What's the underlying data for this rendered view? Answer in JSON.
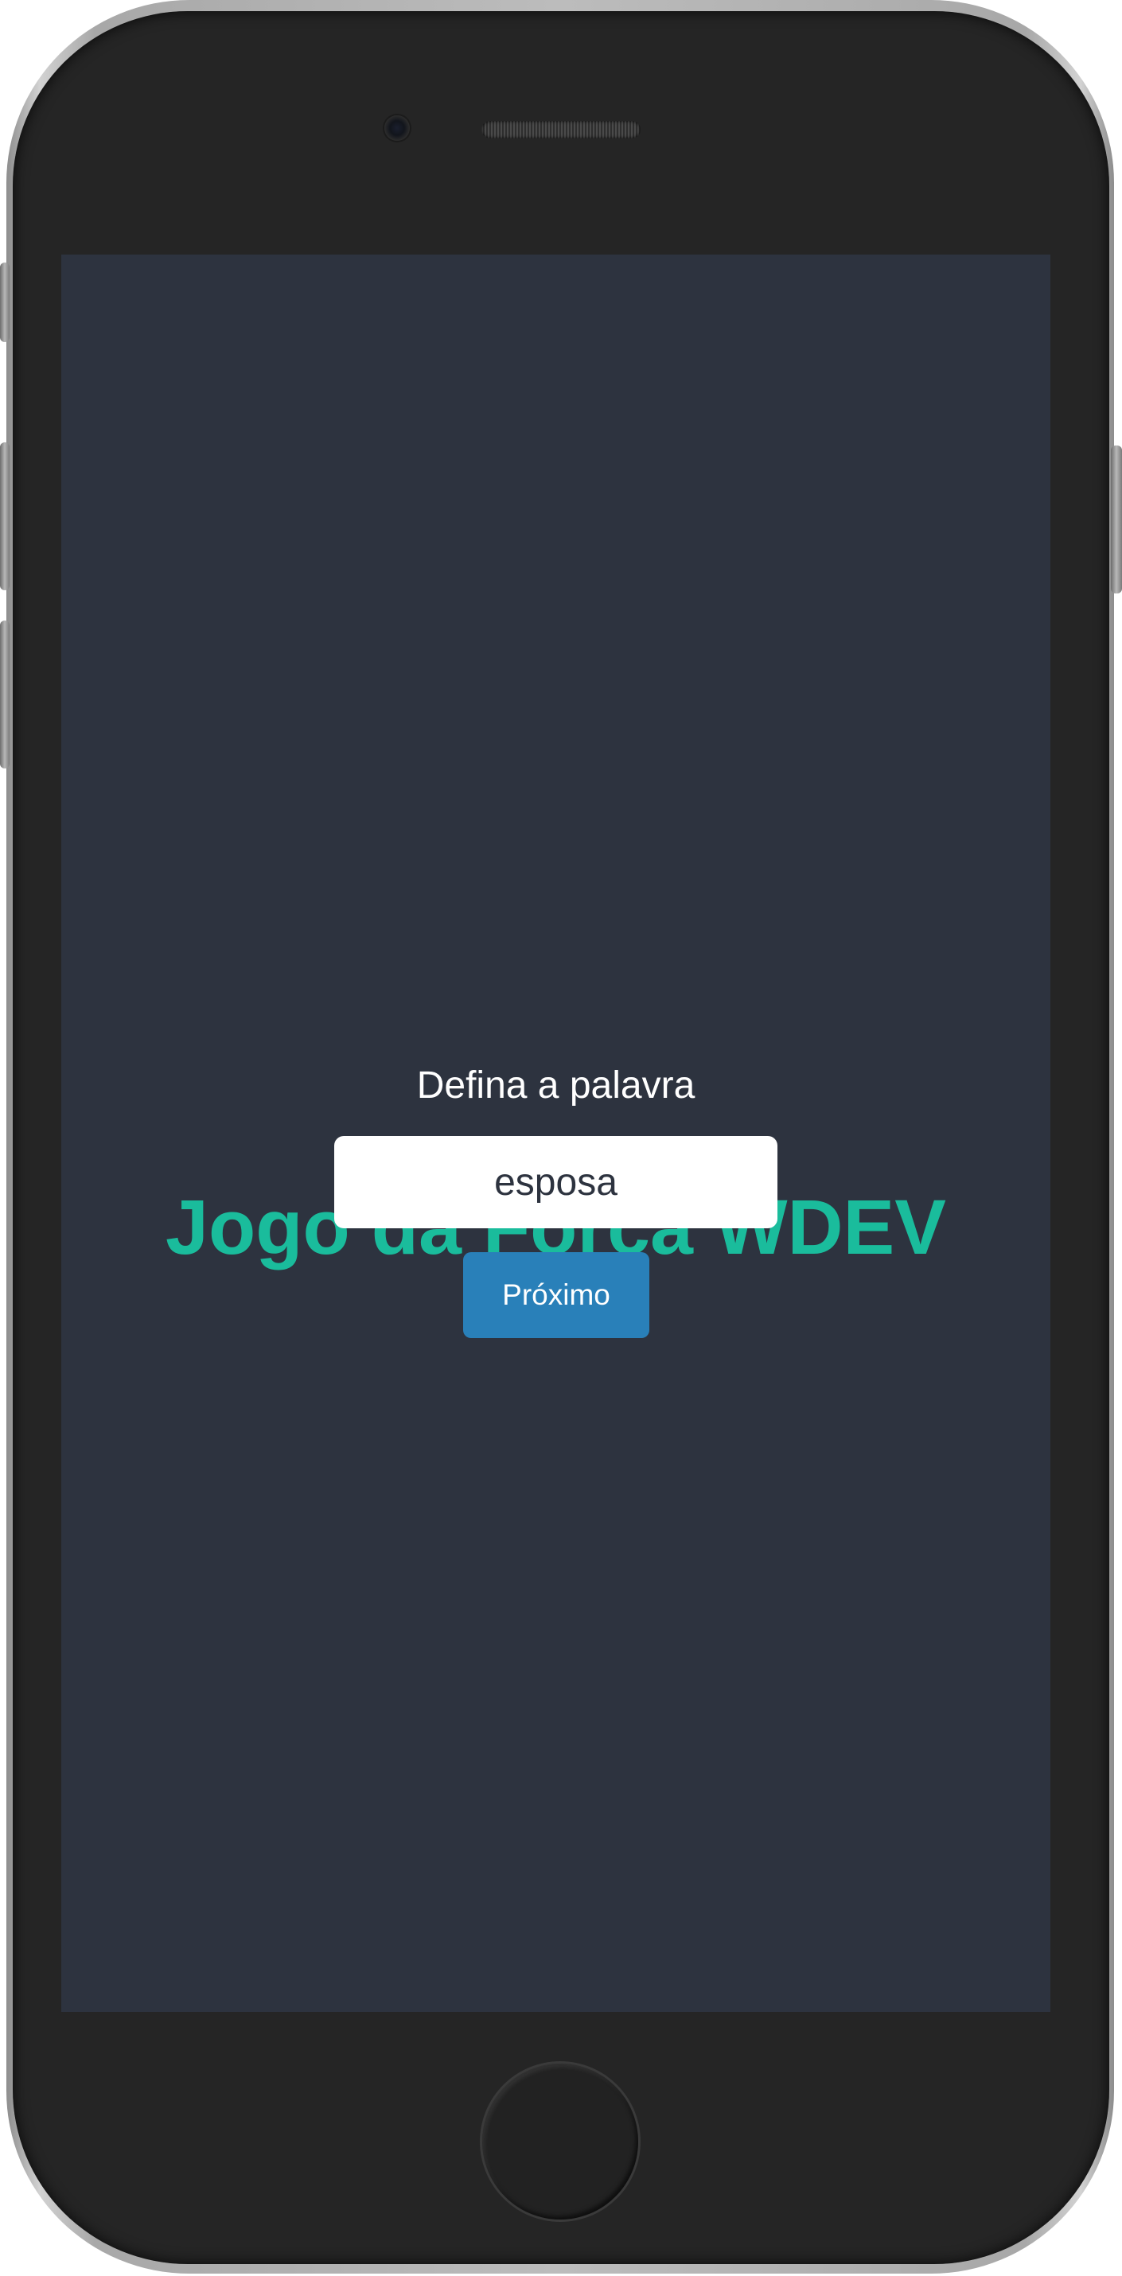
{
  "game": {
    "title": "Jogo da Forca WDEV",
    "prompt_label": "Defina a palavra",
    "word_input_value": "esposa",
    "next_button_label": "Próximo"
  },
  "colors": {
    "screen_background": "#2d333f",
    "title": "#1abc9c",
    "button": "#2980b9",
    "phone_body": "#252525"
  }
}
